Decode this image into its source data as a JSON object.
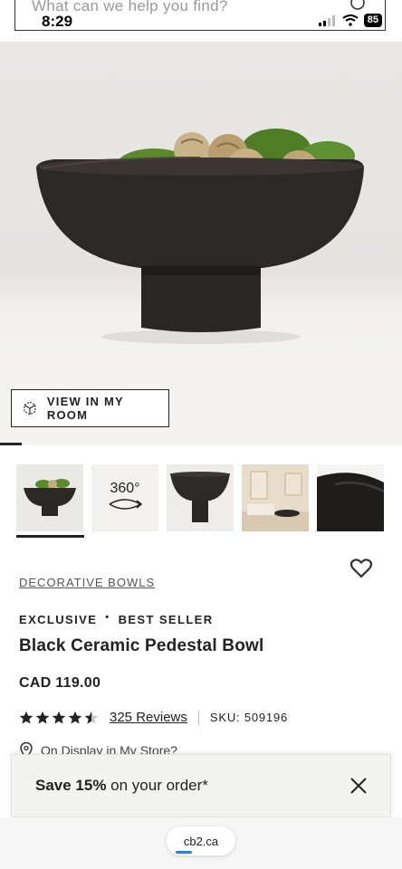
{
  "status_bar": {
    "time": "8:29",
    "battery": "85"
  },
  "search": {
    "placeholder": "What can we help you find?"
  },
  "hero": {
    "view_in_room_label": "VIEW IN MY ROOM"
  },
  "thumbnails": {
    "three_sixty_label": "360°"
  },
  "product": {
    "category": "DECORATIVE BOWLS",
    "tags": [
      "EXCLUSIVE",
      "BEST SELLER"
    ],
    "tag_separator": "•",
    "title": "Black Ceramic Pedestal Bowl",
    "price": "CAD 119.00",
    "rating": 4.5,
    "reviews": "325 Reviews",
    "sku": "SKU: 509196",
    "display": "On Display in My Store?"
  },
  "promo": {
    "save_bold": "Save 15%",
    "save_rest": " on your order*"
  },
  "browser": {
    "url": "cb2.ca"
  },
  "colors": {
    "bowl": "#2c2826",
    "moss": "#5a8a2c",
    "accent_blue": "#2f7fd6"
  },
  "icons": [
    "search-icon",
    "signal-icon",
    "wifi-icon",
    "ar-cube-icon",
    "rotate-360-icon",
    "heart-icon",
    "star-icon",
    "location-pin-icon",
    "close-icon"
  ]
}
